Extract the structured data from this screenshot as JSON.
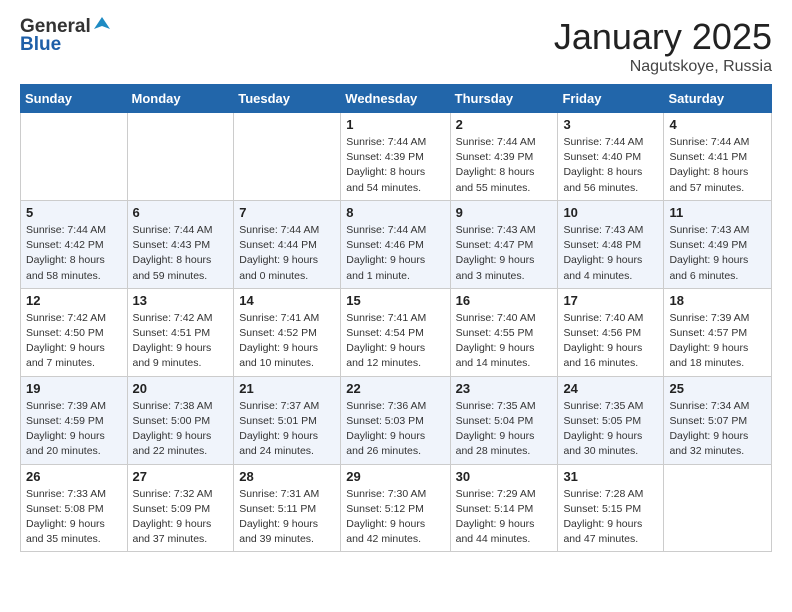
{
  "header": {
    "logo_general": "General",
    "logo_blue": "Blue",
    "month_title": "January 2025",
    "location": "Nagutskoye, Russia"
  },
  "weekdays": [
    "Sunday",
    "Monday",
    "Tuesday",
    "Wednesday",
    "Thursday",
    "Friday",
    "Saturday"
  ],
  "weeks": [
    [
      {
        "day": "",
        "info": ""
      },
      {
        "day": "",
        "info": ""
      },
      {
        "day": "",
        "info": ""
      },
      {
        "day": "1",
        "info": "Sunrise: 7:44 AM\nSunset: 4:39 PM\nDaylight: 8 hours and 54 minutes."
      },
      {
        "day": "2",
        "info": "Sunrise: 7:44 AM\nSunset: 4:39 PM\nDaylight: 8 hours and 55 minutes."
      },
      {
        "day": "3",
        "info": "Sunrise: 7:44 AM\nSunset: 4:40 PM\nDaylight: 8 hours and 56 minutes."
      },
      {
        "day": "4",
        "info": "Sunrise: 7:44 AM\nSunset: 4:41 PM\nDaylight: 8 hours and 57 minutes."
      }
    ],
    [
      {
        "day": "5",
        "info": "Sunrise: 7:44 AM\nSunset: 4:42 PM\nDaylight: 8 hours and 58 minutes."
      },
      {
        "day": "6",
        "info": "Sunrise: 7:44 AM\nSunset: 4:43 PM\nDaylight: 8 hours and 59 minutes."
      },
      {
        "day": "7",
        "info": "Sunrise: 7:44 AM\nSunset: 4:44 PM\nDaylight: 9 hours and 0 minutes."
      },
      {
        "day": "8",
        "info": "Sunrise: 7:44 AM\nSunset: 4:46 PM\nDaylight: 9 hours and 1 minute."
      },
      {
        "day": "9",
        "info": "Sunrise: 7:43 AM\nSunset: 4:47 PM\nDaylight: 9 hours and 3 minutes."
      },
      {
        "day": "10",
        "info": "Sunrise: 7:43 AM\nSunset: 4:48 PM\nDaylight: 9 hours and 4 minutes."
      },
      {
        "day": "11",
        "info": "Sunrise: 7:43 AM\nSunset: 4:49 PM\nDaylight: 9 hours and 6 minutes."
      }
    ],
    [
      {
        "day": "12",
        "info": "Sunrise: 7:42 AM\nSunset: 4:50 PM\nDaylight: 9 hours and 7 minutes."
      },
      {
        "day": "13",
        "info": "Sunrise: 7:42 AM\nSunset: 4:51 PM\nDaylight: 9 hours and 9 minutes."
      },
      {
        "day": "14",
        "info": "Sunrise: 7:41 AM\nSunset: 4:52 PM\nDaylight: 9 hours and 10 minutes."
      },
      {
        "day": "15",
        "info": "Sunrise: 7:41 AM\nSunset: 4:54 PM\nDaylight: 9 hours and 12 minutes."
      },
      {
        "day": "16",
        "info": "Sunrise: 7:40 AM\nSunset: 4:55 PM\nDaylight: 9 hours and 14 minutes."
      },
      {
        "day": "17",
        "info": "Sunrise: 7:40 AM\nSunset: 4:56 PM\nDaylight: 9 hours and 16 minutes."
      },
      {
        "day": "18",
        "info": "Sunrise: 7:39 AM\nSunset: 4:57 PM\nDaylight: 9 hours and 18 minutes."
      }
    ],
    [
      {
        "day": "19",
        "info": "Sunrise: 7:39 AM\nSunset: 4:59 PM\nDaylight: 9 hours and 20 minutes."
      },
      {
        "day": "20",
        "info": "Sunrise: 7:38 AM\nSunset: 5:00 PM\nDaylight: 9 hours and 22 minutes."
      },
      {
        "day": "21",
        "info": "Sunrise: 7:37 AM\nSunset: 5:01 PM\nDaylight: 9 hours and 24 minutes."
      },
      {
        "day": "22",
        "info": "Sunrise: 7:36 AM\nSunset: 5:03 PM\nDaylight: 9 hours and 26 minutes."
      },
      {
        "day": "23",
        "info": "Sunrise: 7:35 AM\nSunset: 5:04 PM\nDaylight: 9 hours and 28 minutes."
      },
      {
        "day": "24",
        "info": "Sunrise: 7:35 AM\nSunset: 5:05 PM\nDaylight: 9 hours and 30 minutes."
      },
      {
        "day": "25",
        "info": "Sunrise: 7:34 AM\nSunset: 5:07 PM\nDaylight: 9 hours and 32 minutes."
      }
    ],
    [
      {
        "day": "26",
        "info": "Sunrise: 7:33 AM\nSunset: 5:08 PM\nDaylight: 9 hours and 35 minutes."
      },
      {
        "day": "27",
        "info": "Sunrise: 7:32 AM\nSunset: 5:09 PM\nDaylight: 9 hours and 37 minutes."
      },
      {
        "day": "28",
        "info": "Sunrise: 7:31 AM\nSunset: 5:11 PM\nDaylight: 9 hours and 39 minutes."
      },
      {
        "day": "29",
        "info": "Sunrise: 7:30 AM\nSunset: 5:12 PM\nDaylight: 9 hours and 42 minutes."
      },
      {
        "day": "30",
        "info": "Sunrise: 7:29 AM\nSunset: 5:14 PM\nDaylight: 9 hours and 44 minutes."
      },
      {
        "day": "31",
        "info": "Sunrise: 7:28 AM\nSunset: 5:15 PM\nDaylight: 9 hours and 47 minutes."
      },
      {
        "day": "",
        "info": ""
      }
    ]
  ]
}
